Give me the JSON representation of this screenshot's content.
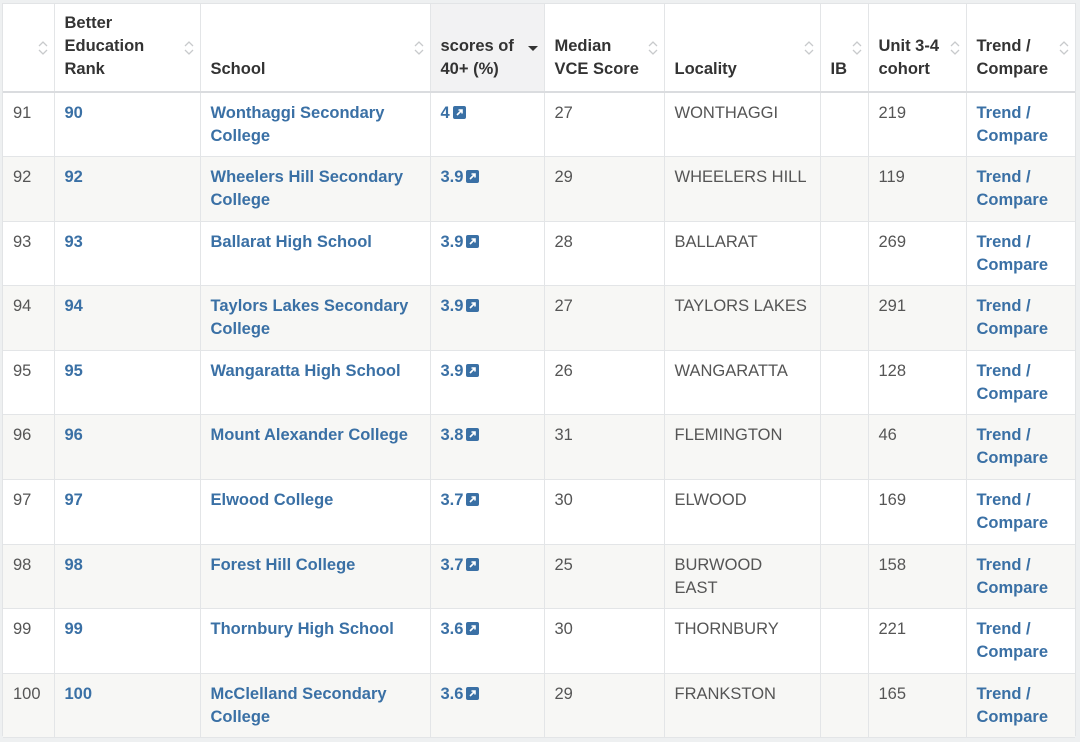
{
  "colors": {
    "link": "#3a70a5",
    "stripe": "#f7f7f5",
    "sorted_header": "#f2f2f3"
  },
  "headers": [
    {
      "label": "",
      "sortable": true
    },
    {
      "label": "Better Education Rank",
      "sortable": true
    },
    {
      "label": "School",
      "sortable": true
    },
    {
      "label": "scores of 40+ (%)",
      "sortable": true,
      "sorted": "desc"
    },
    {
      "label": "Median VCE Score",
      "sortable": true
    },
    {
      "label": "Locality",
      "sortable": true
    },
    {
      "label": "IB",
      "sortable": true
    },
    {
      "label": "Unit 3-4 cohort",
      "sortable": true
    },
    {
      "label": "Trend / Compare",
      "sortable": true
    }
  ],
  "rows": [
    {
      "index": "91",
      "rank": "90",
      "school": "Wonthaggi Secondary College",
      "score": "4",
      "median": "27",
      "locality": "WONTHAGGI",
      "ib": "",
      "cohort": "219",
      "trend": "Trend / Compare"
    },
    {
      "index": "92",
      "rank": "92",
      "school": "Wheelers Hill Secondary College",
      "score": "3.9",
      "median": "29",
      "locality": "WHEELERS HILL",
      "ib": "",
      "cohort": "119",
      "trend": "Trend / Compare"
    },
    {
      "index": "93",
      "rank": "93",
      "school": "Ballarat High School",
      "score": "3.9",
      "median": "28",
      "locality": "BALLARAT",
      "ib": "",
      "cohort": "269",
      "trend": "Trend / Compare"
    },
    {
      "index": "94",
      "rank": "94",
      "school": "Taylors Lakes Secondary College",
      "score": "3.9",
      "median": "27",
      "locality": "TAYLORS LAKES",
      "ib": "",
      "cohort": "291",
      "trend": "Trend / Compare"
    },
    {
      "index": "95",
      "rank": "95",
      "school": "Wangaratta High School",
      "score": "3.9",
      "median": "26",
      "locality": "WANGARATTA",
      "ib": "",
      "cohort": "128",
      "trend": "Trend / Compare"
    },
    {
      "index": "96",
      "rank": "96",
      "school": "Mount Alexander College",
      "score": "3.8",
      "median": "31",
      "locality": "FLEMINGTON",
      "ib": "",
      "cohort": "46",
      "trend": "Trend / Compare"
    },
    {
      "index": "97",
      "rank": "97",
      "school": "Elwood College",
      "score": "3.7",
      "median": "30",
      "locality": "ELWOOD",
      "ib": "",
      "cohort": "169",
      "trend": "Trend / Compare"
    },
    {
      "index": "98",
      "rank": "98",
      "school": "Forest Hill College",
      "score": "3.7",
      "median": "25",
      "locality": "BURWOOD EAST",
      "ib": "",
      "cohort": "158",
      "trend": "Trend / Compare"
    },
    {
      "index": "99",
      "rank": "99",
      "school": "Thornbury High School",
      "score": "3.6",
      "median": "30",
      "locality": "THORNBURY",
      "ib": "",
      "cohort": "221",
      "trend": "Trend / Compare"
    },
    {
      "index": "100",
      "rank": "100",
      "school": "McClelland Secondary College",
      "score": "3.6",
      "median": "29",
      "locality": "FRANKSTON",
      "ib": "",
      "cohort": "165",
      "trend": "Trend / Compare"
    }
  ]
}
